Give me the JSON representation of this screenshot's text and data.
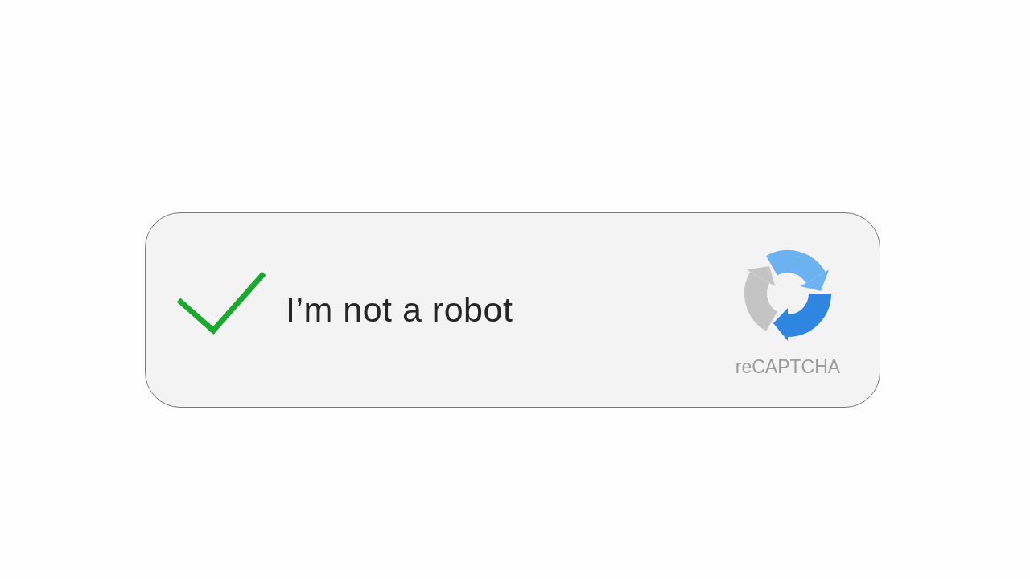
{
  "captcha": {
    "checked": true,
    "label": "I’m not a robot",
    "brand": "reCAPTCHA"
  }
}
